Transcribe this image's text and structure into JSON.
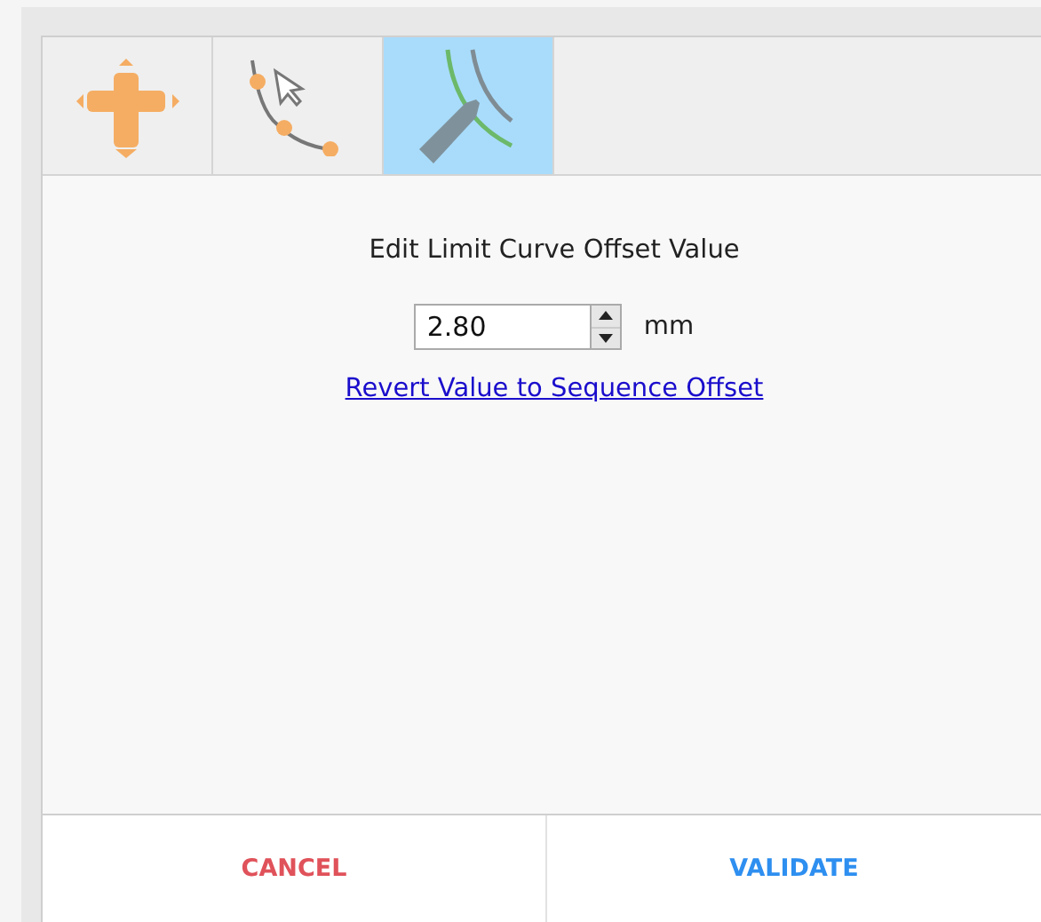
{
  "tabs": [
    {
      "kind": "move",
      "selected": false
    },
    {
      "kind": "curve",
      "selected": false
    },
    {
      "kind": "offset",
      "selected": true
    }
  ],
  "editor": {
    "title": "Edit Limit Curve Offset Value",
    "value": "2.80",
    "unit": "mm",
    "link": "Revert Value to Sequence Offset"
  },
  "buttons": [
    {
      "kind": "cancel",
      "label": "CANCEL"
    },
    {
      "kind": "validate",
      "label": "VALIDATE"
    }
  ]
}
